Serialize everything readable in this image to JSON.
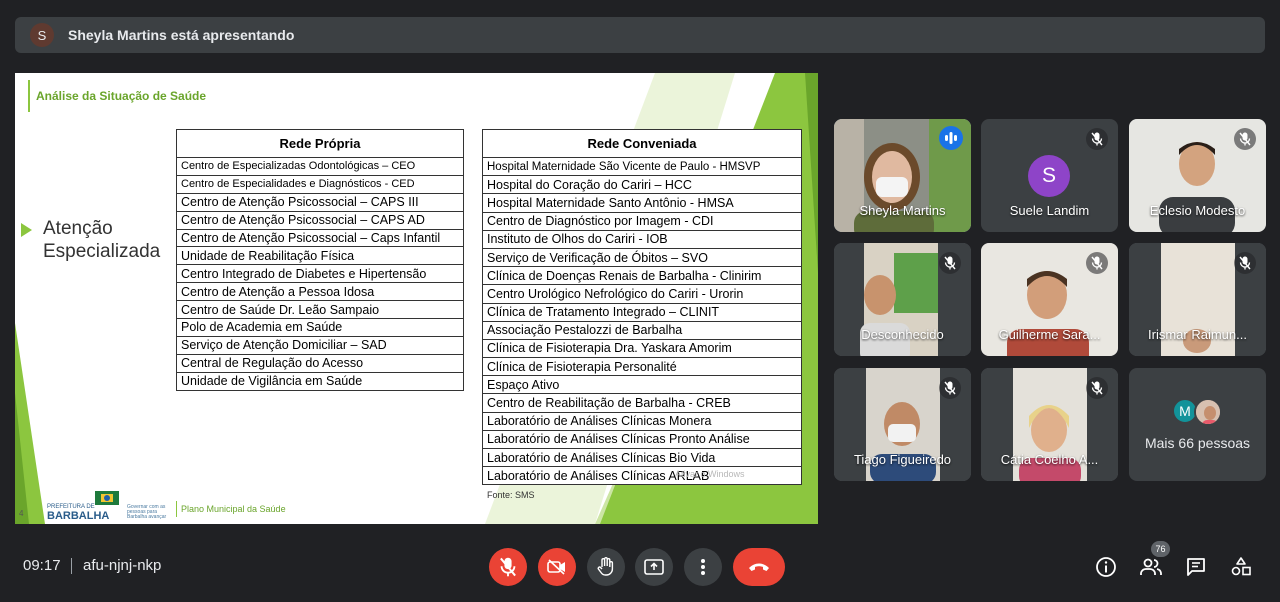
{
  "presenter": {
    "avatar_letter": "S",
    "text": "Sheyla Martins está apresentando"
  },
  "slide": {
    "title": "Análise da Situação de Saúde",
    "side_title_line1": "Atenção",
    "side_title_line2": "Especializada",
    "rede_propria": {
      "header": "Rede Própria",
      "rows": [
        "Centro de Especializadas Odontológicas – CEO",
        "Centro de Especialidades e Diagnósticos - CED",
        "Centro de Atenção Psicossocial – CAPS III",
        "Centro de Atenção Psicossocial – CAPS AD",
        "Centro de Atenção Psicossocial – Caps Infantil",
        "Unidade de Reabilitação Física",
        "Centro Integrado de Diabetes e Hipertensão",
        "Centro de Atenção a Pessoa Idosa",
        "Centro de Saúde Dr. Leão Sampaio",
        "Polo de Academia em Saúde",
        "Serviço de Atenção Domiciliar – SAD",
        "Central de Regulação do Acesso",
        "Unidade de Vigilância em Saúde"
      ]
    },
    "rede_conveniada": {
      "header": "Rede Conveniada",
      "rows": [
        "Hospital Maternidade São Vicente de Paulo - HMSVP",
        "Hospital do Coração do Cariri – HCC",
        "Hospital Maternidade Santo Antônio - HMSA",
        "Centro de Diagnóstico por Imagem - CDI",
        "Instituto de Olhos do Cariri - IOB",
        "Serviço de Verificação de Óbitos – SVO",
        "Clínica de Doenças Renais de Barbalha - Clinirim",
        "Centro Urológico Nefrológico do Cariri - Urorin",
        "Clínica de Tratamento Integrado – CLINIT",
        "Associação Pestalozzi de Barbalha",
        "Clínica de Fisioterapia Dra. Yaskara Amorim",
        "Clínica de Fisioterapia Personalité",
        "Espaço Ativo",
        "Centro de Reabilitação de Barbalha - CREB",
        "Laboratório de Análises Clínicas Monera",
        "Laboratório de Análises Clínicas Pronto Análise",
        "Laboratório de Análises Clínicas Bio Vida",
        "Laboratório de Análises Clínicas ARLAB"
      ]
    },
    "fonte": "Fonte: SMS",
    "watermark": "Ativar o Windows",
    "logo_line1": "PREFEITURA DE",
    "logo_line2": "BARBALHA",
    "logo_tagline": "Governar com as pessoas para Barbalha avançar",
    "footer": "Plano Municipal da Saúde",
    "slide_number": "4"
  },
  "participants": [
    {
      "name": "Sheyla Martins",
      "type": "video",
      "speaking": true
    },
    {
      "name": "Suele Landim",
      "type": "avatar",
      "avatar_letter": "S",
      "muted": true
    },
    {
      "name": "Eclesio Modesto",
      "type": "video",
      "muted": true
    },
    {
      "name": "Desconhecido",
      "type": "video",
      "muted": true
    },
    {
      "name": "Guilherme Sara...",
      "type": "video",
      "muted": true
    },
    {
      "name": "Irismar Raimun...",
      "type": "video",
      "muted": true
    },
    {
      "name": "Tiago Figueiredo",
      "type": "video",
      "muted": true
    },
    {
      "name": "Cátia Coelho A...",
      "type": "video",
      "muted": true
    }
  ],
  "more_people": {
    "avatar_letter": "M",
    "label": "Mais 66 pessoas"
  },
  "bottom_bar": {
    "time": "09:17",
    "meeting_code": "afu-njnj-nkp",
    "participant_count": "76"
  },
  "colors": {
    "end_call": "#ea4335",
    "accent": "#8ab4f8",
    "slide_green": "#8cc63f"
  }
}
